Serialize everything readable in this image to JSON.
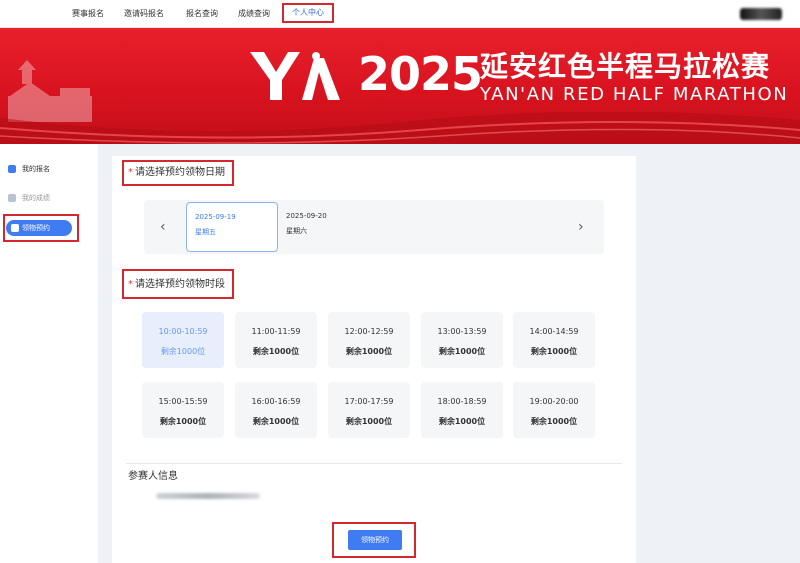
{
  "nav": {
    "items": [
      {
        "label": "赛事报名"
      },
      {
        "label": "邀请码报名"
      },
      {
        "label": "报名查询"
      },
      {
        "label": "成绩查询"
      },
      {
        "label": "个人中心"
      }
    ],
    "active_index": 4
  },
  "banner": {
    "logo_text": "YA",
    "year": "2025",
    "title_cn": "延安红色半程马拉松赛",
    "title_en": "YAN'AN RED HALF MARATHON"
  },
  "sidebar": {
    "items": [
      {
        "label": "我的报名"
      },
      {
        "label": "我的成绩"
      },
      {
        "label": "领物预约"
      }
    ],
    "active_index": 2
  },
  "date_section": {
    "required_mark": "*",
    "title": "请选择预约领物日期",
    "prev_arrow": "‹",
    "next_arrow": "›",
    "dates": [
      {
        "date": "2025-09-19",
        "weekday": "星期五",
        "selected": true
      },
      {
        "date": "2025-09-20",
        "weekday": "星期六",
        "selected": false
      }
    ]
  },
  "slot_section": {
    "required_mark": "*",
    "title": "请选择预约领物时段",
    "slots": [
      {
        "time": "10:00-10:59",
        "remaining": "剩余1000位",
        "selected": true
      },
      {
        "time": "11:00-11:59",
        "remaining": "剩余1000位",
        "selected": false
      },
      {
        "time": "12:00-12:59",
        "remaining": "剩余1000位",
        "selected": false
      },
      {
        "time": "13:00-13:59",
        "remaining": "剩余1000位",
        "selected": false
      },
      {
        "time": "14:00-14:59",
        "remaining": "剩余1000位",
        "selected": false
      },
      {
        "time": "15:00-15:59",
        "remaining": "剩余1000位",
        "selected": false
      },
      {
        "time": "16:00-16:59",
        "remaining": "剩余1000位",
        "selected": false
      },
      {
        "time": "17:00-17:59",
        "remaining": "剩余1000位",
        "selected": false
      },
      {
        "time": "18:00-18:59",
        "remaining": "剩余1000位",
        "selected": false
      },
      {
        "time": "19:00-20:00",
        "remaining": "剩余1000位",
        "selected": false
      }
    ]
  },
  "participant": {
    "title": "参赛人信息"
  },
  "submit_label": "领物预约",
  "colors": {
    "accent": "#3f7cf1",
    "banner_red": "#d8131f",
    "highlight_box": "#d6262e"
  }
}
